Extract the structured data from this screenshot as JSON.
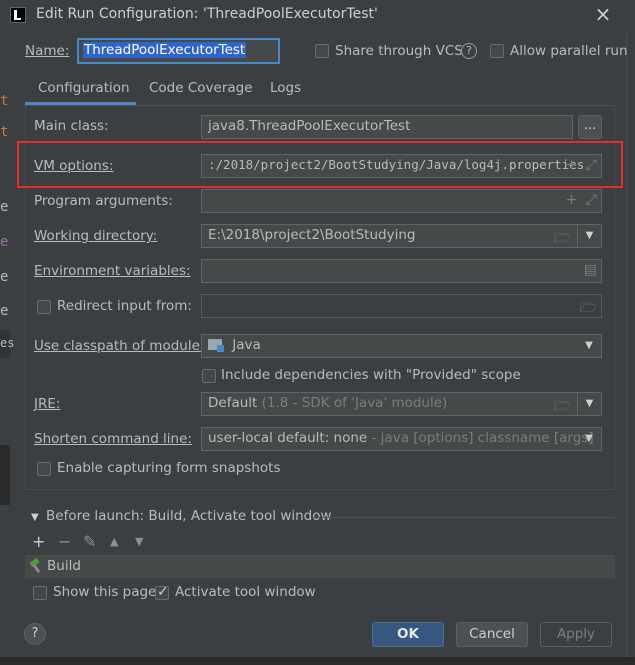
{
  "window": {
    "title": "Edit Run Configuration: 'ThreadPoolExecutorTest'",
    "close_glyph": "×"
  },
  "name": {
    "label": "Name:",
    "value": "ThreadPoolExecutorTest",
    "share_label": "Share through VCS",
    "help_glyph": "?",
    "parallel_label": "Allow parallel run"
  },
  "tabs": [
    {
      "label": "Configuration",
      "active": true
    },
    {
      "label": "Code Coverage",
      "active": false
    },
    {
      "label": "Logs",
      "active": false
    }
  ],
  "fields": {
    "main_class": {
      "label": "Main class:",
      "value": "java8.ThreadPoolExecutorTest",
      "browse_label": "..."
    },
    "vm_options": {
      "label": "VM options:",
      "value": ":/2018/project2/BootStudying/Java/log4j.properties"
    },
    "program_arguments": {
      "label": "Program arguments:",
      "value": ""
    },
    "working_directory": {
      "label": "Working directory:",
      "value": "E:\\2018\\project2\\BootStudying"
    },
    "environment_variables": {
      "label": "Environment variables:",
      "value": ""
    },
    "redirect_input": {
      "label": "Redirect input from:",
      "value": "",
      "checked": false
    },
    "classpath_module": {
      "label": "Use classpath of module:",
      "value": "Java"
    },
    "include_deps": {
      "label": "Include dependencies with \"Provided\" scope",
      "checked": false
    },
    "jre": {
      "label": "JRE:",
      "value": "Default",
      "hint": "(1.8 - SDK of 'Java' module)"
    },
    "shorten_command_line": {
      "label": "Shorten command line:",
      "value": "user-local default: none",
      "hint": "- java [options] classname [args]"
    },
    "capture_snapshots": {
      "label": "Enable capturing form snapshots",
      "checked": false
    }
  },
  "before_launch": {
    "label": "Before launch: Build, Activate tool window",
    "toolbar": {
      "add": "+",
      "remove": "−",
      "edit": "✎",
      "up": "▲",
      "down": "▼"
    },
    "items": [
      "Build"
    ]
  },
  "options": {
    "show_page": {
      "label": "Show this page",
      "checked": false
    },
    "activate_tool_window": {
      "label": "Activate tool window",
      "checked": true
    }
  },
  "buttons": {
    "help": "?",
    "ok": "OK",
    "cancel": "Cancel",
    "apply": "Apply"
  },
  "colors": {
    "accent": "#4a88c7",
    "highlight_box": "#e0302b",
    "background": "#3c3f41"
  }
}
